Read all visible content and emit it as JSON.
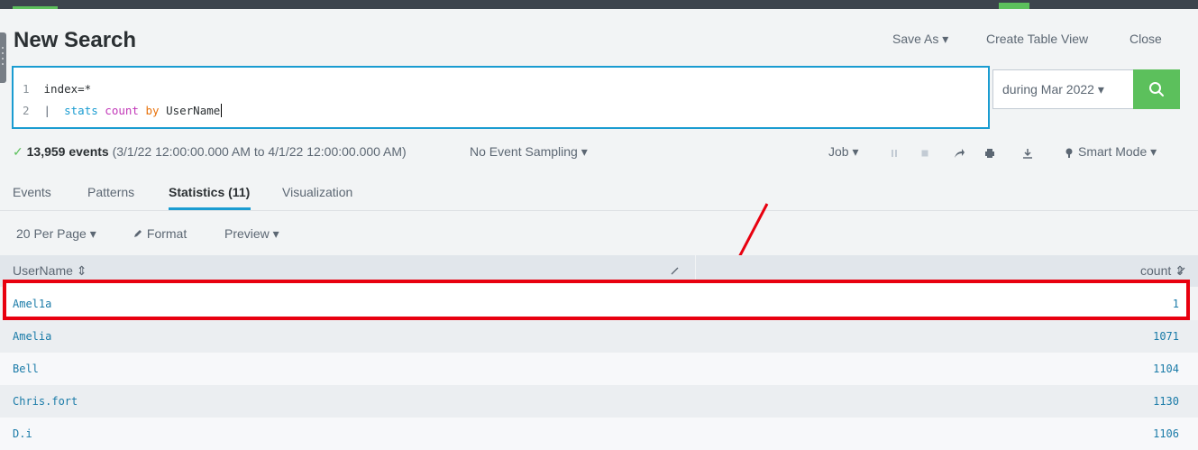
{
  "header": {
    "title": "New Search",
    "save_as": "Save As ▾",
    "create_table_view": "Create Table View",
    "close": "Close"
  },
  "search": {
    "line1_num": "1",
    "line1": "index=*",
    "line2_num": "2",
    "line2_pipe": "|",
    "line2_cmd": "stats",
    "line2_fn": "count",
    "line2_by": "by",
    "line2_field": "UserName",
    "time_range": "during Mar 2022 ▾"
  },
  "status": {
    "check": "✓",
    "events_count": "13,959 events",
    "range": "(3/1/22 12:00:00.000 AM to 4/1/22 12:00:00.000 AM)",
    "sampling": "No Event Sampling ▾",
    "job": "Job ▾",
    "mode": "Smart Mode ▾"
  },
  "tabs": [
    "Events",
    "Patterns",
    "Statistics (11)",
    "Visualization"
  ],
  "options": {
    "per_page": "20 Per Page ▾",
    "format": "Format",
    "preview": "Preview ▾"
  },
  "table": {
    "col_username": "UserName ⇕",
    "col_count": "count ⇕",
    "rows": [
      {
        "username": "Amel1a",
        "count": "1"
      },
      {
        "username": "Amelia",
        "count": "1071"
      },
      {
        "username": "Bell",
        "count": "1104"
      },
      {
        "username": "Chris.fort",
        "count": "1130"
      },
      {
        "username": "D.i",
        "count": "1106"
      }
    ]
  },
  "icons": [
    "search-icon",
    "pause-icon",
    "stop-icon",
    "share-icon",
    "print-icon",
    "download-icon",
    "smart-mode-icon",
    "pencil-icon"
  ],
  "colors": {
    "accent": "#1a9cd1",
    "go_button": "#5cc05c",
    "highlight": "#e8000f"
  }
}
